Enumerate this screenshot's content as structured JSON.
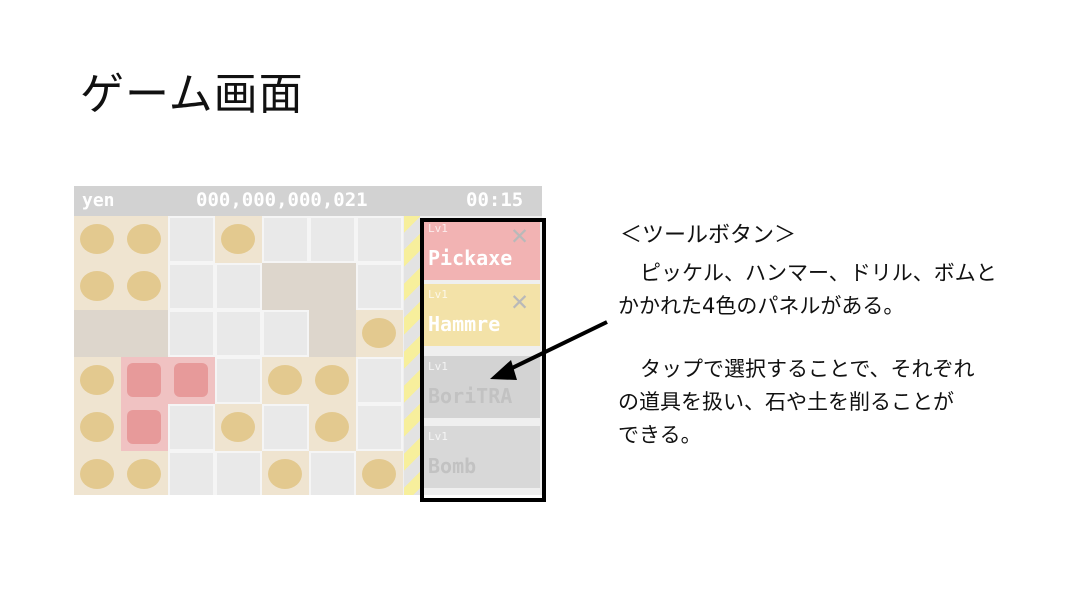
{
  "slide": {
    "title": "ゲーム画面",
    "heading": "＜ツールボタン＞",
    "para1_line1": "ピッケル、ハンマー、ドリル、ボムと",
    "para1_line2": "かかれた4色のパネルがある。",
    "para2_line1": "タップで選択することで、それぞれ",
    "para2_line2": "の道具を扱い、石や土を削ることが",
    "para2_line3": "できる。"
  },
  "game": {
    "currency": "yen",
    "money": "000,000,000,021",
    "timer": "00:15",
    "panels": [
      {
        "level": "Lv1",
        "name": "Pickaxe"
      },
      {
        "level": "Lv1",
        "name": "Hammre"
      },
      {
        "level": "Lv1",
        "name": "BoriTRA"
      },
      {
        "level": "Lv1",
        "name": "Bomb"
      }
    ],
    "colors": {
      "pickaxe": "#f2b3b3",
      "hammer": "#f3e2a8",
      "drill": "#d3d3d3",
      "bomb": "#d8d8d8",
      "highlight": "#000000"
    }
  }
}
